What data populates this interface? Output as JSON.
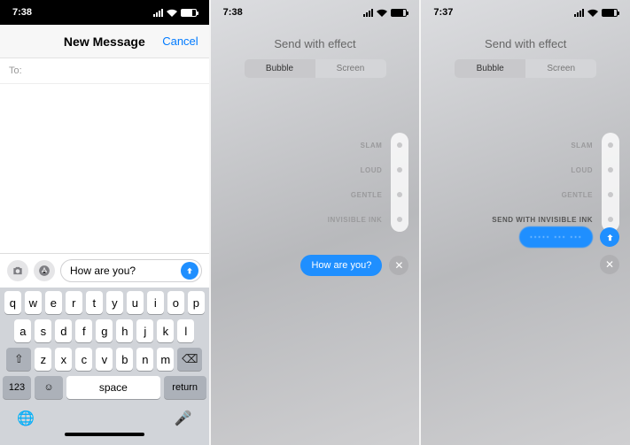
{
  "screen1": {
    "time": "7:38",
    "title": "New Message",
    "cancel": "Cancel",
    "to_label": "To:",
    "message_text": "How are you?",
    "key_123": "123",
    "key_space": "space",
    "key_return": "return",
    "rows": {
      "r1": [
        "q",
        "w",
        "e",
        "r",
        "t",
        "y",
        "u",
        "i",
        "o",
        "p"
      ],
      "r2": [
        "a",
        "s",
        "d",
        "f",
        "g",
        "h",
        "j",
        "k",
        "l"
      ],
      "r3": [
        "z",
        "x",
        "c",
        "v",
        "b",
        "n",
        "m"
      ]
    }
  },
  "screen2": {
    "time": "7:38",
    "title": "Send with effect",
    "tab_bubble": "Bubble",
    "tab_screen": "Screen",
    "effects": [
      "SLAM",
      "LOUD",
      "GENTLE",
      "INVISIBLE INK"
    ],
    "bubble_text": "How are you?"
  },
  "screen3": {
    "time": "7:37",
    "title": "Send with effect",
    "tab_bubble": "Bubble",
    "tab_screen": "Screen",
    "effects": [
      "SLAM",
      "LOUD",
      "GENTLE",
      "SEND WITH INVISIBLE INK"
    ],
    "bubble_text": "····· ··· ···"
  }
}
